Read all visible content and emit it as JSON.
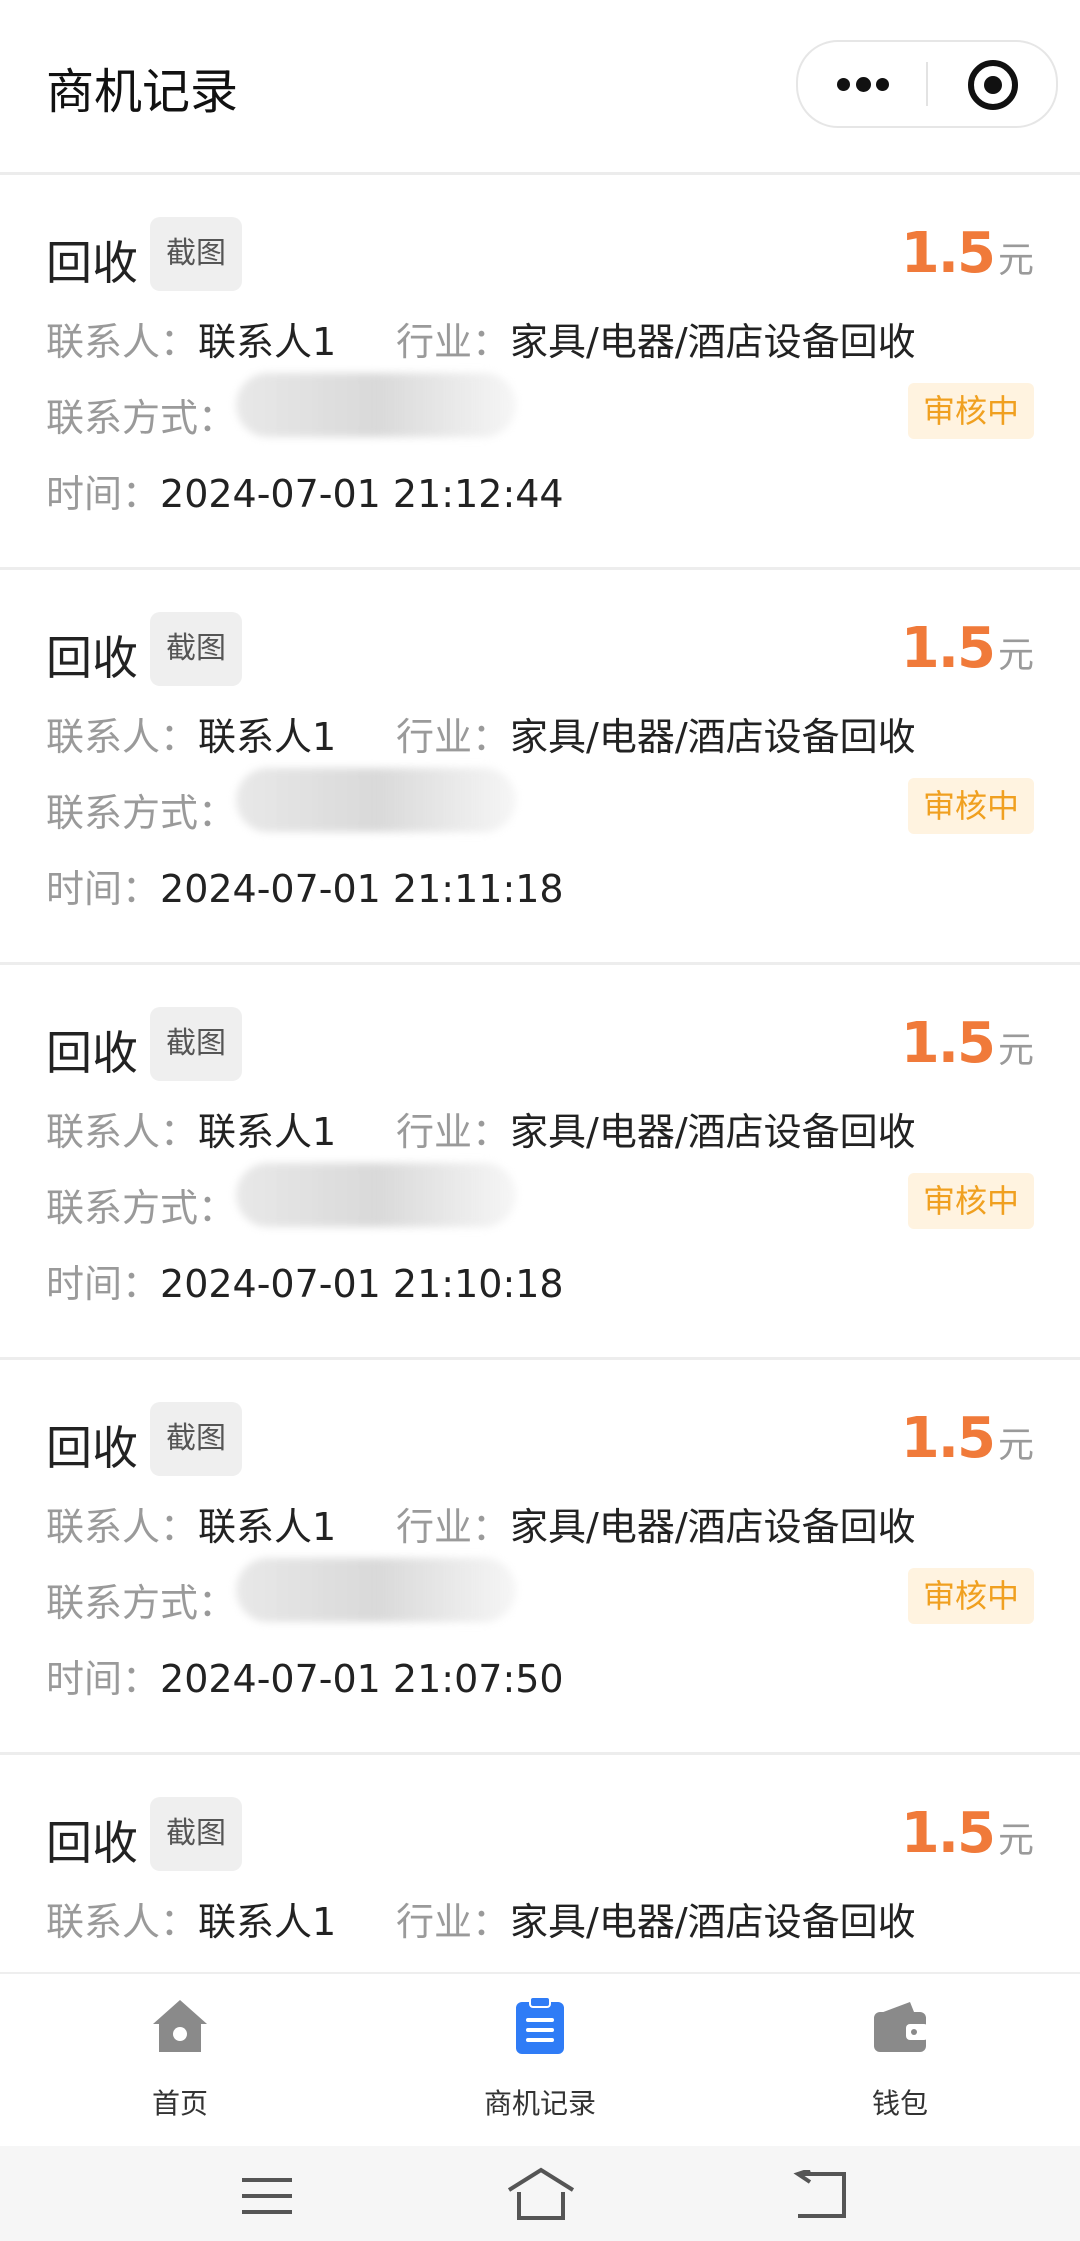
{
  "header": {
    "title": "商机记录"
  },
  "records": [
    {
      "type": "回收",
      "screenshot_label": "截图",
      "price": "1.5",
      "unit": "元",
      "contact_label": "联系人：",
      "contact": "联系人1",
      "industry_label": "行业：",
      "industry": "家具/电器/酒店设备回收",
      "method_label": "联系方式：",
      "status": "审核中",
      "time_label": "时间：",
      "time": "2024-07-01 21:12:44"
    },
    {
      "type": "回收",
      "screenshot_label": "截图",
      "price": "1.5",
      "unit": "元",
      "contact_label": "联系人：",
      "contact": "联系人1",
      "industry_label": "行业：",
      "industry": "家具/电器/酒店设备回收",
      "method_label": "联系方式：",
      "status": "审核中",
      "time_label": "时间：",
      "time": "2024-07-01 21:11:18"
    },
    {
      "type": "回收",
      "screenshot_label": "截图",
      "price": "1.5",
      "unit": "元",
      "contact_label": "联系人：",
      "contact": "联系人1",
      "industry_label": "行业：",
      "industry": "家具/电器/酒店设备回收",
      "method_label": "联系方式：",
      "status": "审核中",
      "time_label": "时间：",
      "time": "2024-07-01 21:10:18"
    },
    {
      "type": "回收",
      "screenshot_label": "截图",
      "price": "1.5",
      "unit": "元",
      "contact_label": "联系人：",
      "contact": "联系人1",
      "industry_label": "行业：",
      "industry": "家具/电器/酒店设备回收",
      "method_label": "联系方式：",
      "status": "审核中",
      "time_label": "时间：",
      "time": "2024-07-01 21:07:50"
    },
    {
      "type": "回收",
      "screenshot_label": "截图",
      "price": "1.5",
      "unit": "元",
      "contact_label": "联系人：",
      "contact": "联系人1",
      "industry_label": "行业：",
      "industry": "家具/电器/酒店设备回收"
    }
  ],
  "tabbar": {
    "items": [
      {
        "label": "首页",
        "icon": "home-icon"
      },
      {
        "label": "商机记录",
        "icon": "clipboard-icon"
      },
      {
        "label": "钱包",
        "icon": "wallet-icon"
      }
    ],
    "active_color": "#2f7cf6",
    "inactive_color": "#8a8a8a"
  },
  "colors": {
    "price": "#f07a3a",
    "status_text": "#f0a020",
    "status_bg": "#fff3e0"
  }
}
